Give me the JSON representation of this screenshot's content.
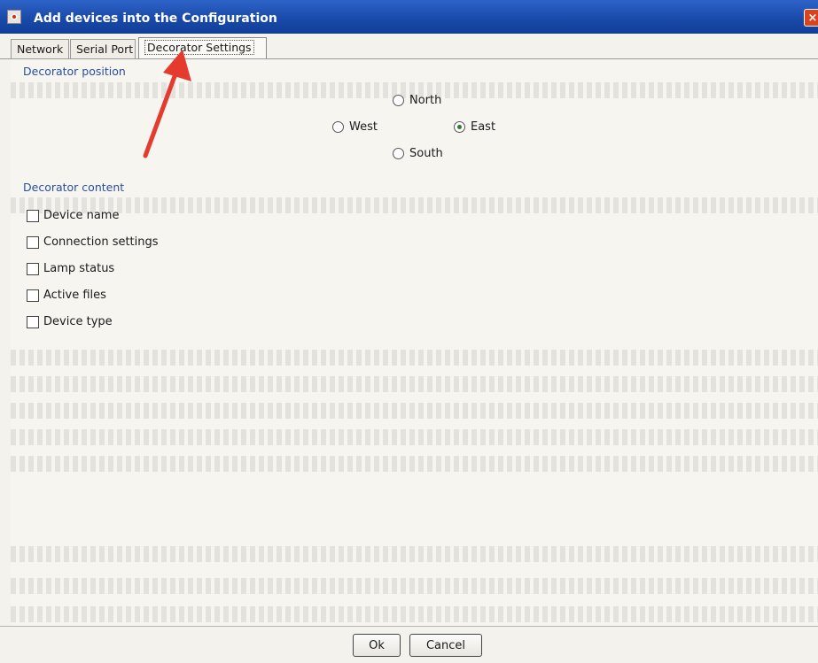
{
  "window": {
    "title": "Add devices into the Configuration",
    "close_label": "×"
  },
  "tabs": [
    {
      "label": "Network"
    },
    {
      "label": "Serial Port"
    },
    {
      "label": "Decorator Settings",
      "active": true
    }
  ],
  "decorator_position": {
    "label": "Decorator position",
    "options": [
      "North",
      "West",
      "East",
      "South"
    ],
    "selected": "East"
  },
  "decorator_content": {
    "label": "Decorator content",
    "items": [
      {
        "label": "Device name",
        "checked": false
      },
      {
        "label": "Connection settings",
        "checked": false
      },
      {
        "label": "Lamp status",
        "checked": false
      },
      {
        "label": "Active files",
        "checked": false
      },
      {
        "label": "Device type",
        "checked": false
      }
    ]
  },
  "buttons": {
    "ok": "Ok",
    "cancel": "Cancel"
  },
  "colors": {
    "title_bar": "#1848a8",
    "section_label": "#2a4fa0",
    "arrow": "#e53a2e"
  },
  "icons": {
    "app": "app-icon",
    "close": "close-icon",
    "annotation": "red-arrow-icon"
  }
}
